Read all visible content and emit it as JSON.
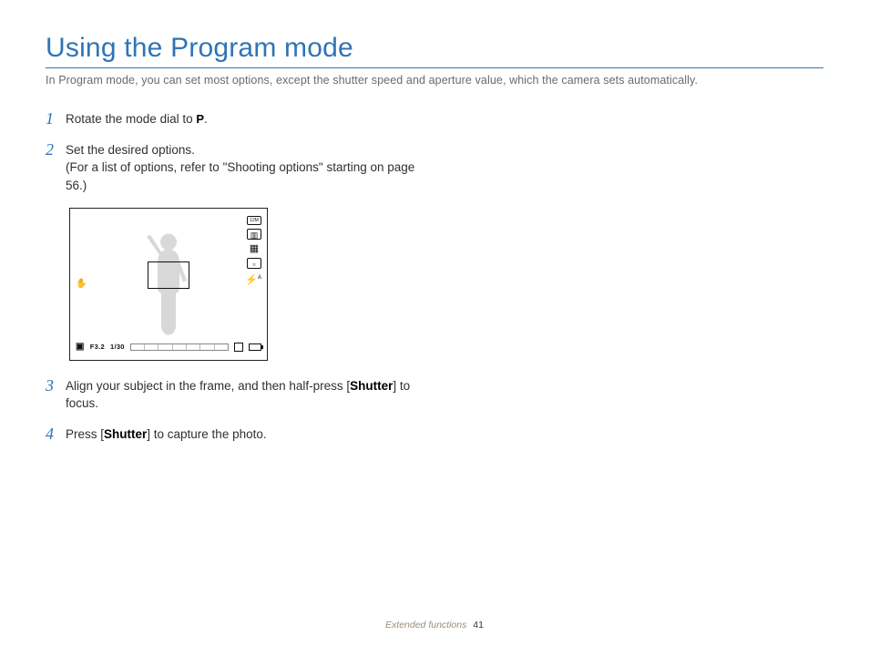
{
  "title": "Using the Program mode",
  "intro": "In Program mode, you can set most options, except the shutter speed and aperture value, which the camera sets automatically.",
  "steps": {
    "s1": {
      "num": "1",
      "a": "Rotate the mode dial to ",
      "icon": "P",
      "b": "."
    },
    "s2": {
      "num": "2",
      "a": "Set the desired options.",
      "b": "(For a list of options, refer to \"Shooting options\" starting on page 56.)"
    },
    "s3": {
      "num": "3",
      "a": "Align your subject in the frame, and then half-press [",
      "shutter": "Shutter",
      "b": "] to focus."
    },
    "s4": {
      "num": "4",
      "a": "Press [",
      "shutter": "Shutter",
      "b": "] to capture the photo."
    }
  },
  "lcd": {
    "aperture": "F3.2",
    "shutter": "1/30",
    "flash_auto_suffix": "A",
    "size_label": "12M"
  },
  "footer": {
    "section": "Extended functions",
    "page": "41"
  }
}
